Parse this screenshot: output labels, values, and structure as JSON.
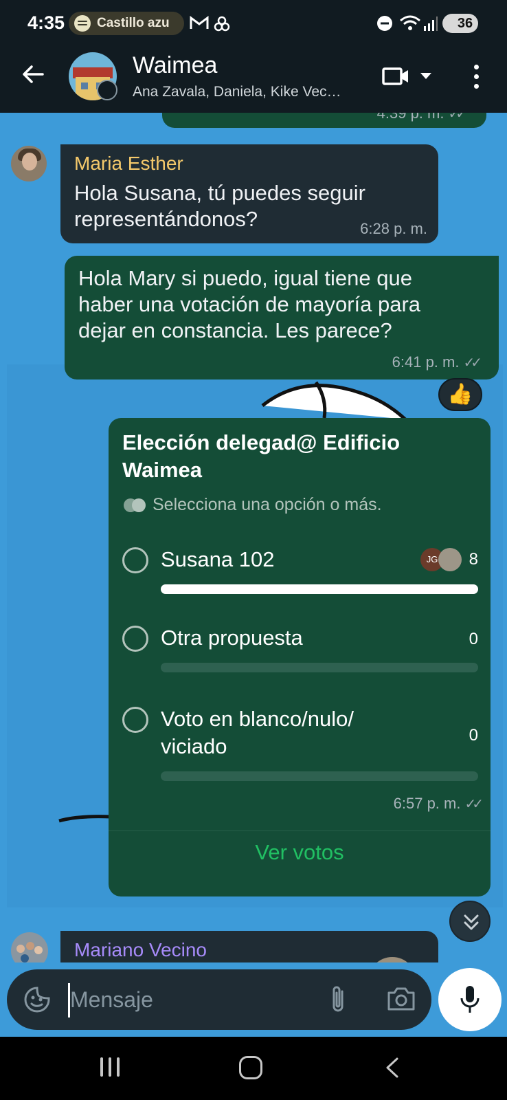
{
  "status_bar": {
    "time": "4:35",
    "media_pill_text": "Castillo azu",
    "battery": "36"
  },
  "header": {
    "title": "Waimea",
    "subtitle": "Ana Zavala, Daniela, Kike Vec…"
  },
  "messages": {
    "top_partial": {
      "time": "4:39 p. m."
    },
    "maria": {
      "sender": "Maria Esther",
      "text": "Hola Susana, tú puedes seguir representándonos?",
      "time": "6:28 p. m."
    },
    "susana": {
      "text": "Hola Mary si puedo, igual tiene que haber una votación de mayoría para dejar en constancia. Les parece?",
      "time": "6:41 p. m.",
      "reaction": "👍"
    },
    "poll": {
      "title": "Elección delegad@ Edificio Waimea",
      "hint": "Selecciona una opción o más.",
      "options": [
        {
          "label": "Susana 102",
          "count": "8",
          "fraction": 1.0,
          "voter_initials": "JG"
        },
        {
          "label": "Otra propuesta",
          "count": "0",
          "fraction": 0.0
        },
        {
          "label": "Voto en blanco/nulo/ viciado",
          "count": "0",
          "fraction": 0.0
        }
      ],
      "time": "6:57 p. m.",
      "link": "Ver votos"
    },
    "mariano": {
      "sender": "Mariano Vecino"
    }
  },
  "composer": {
    "placeholder": "Mensaje"
  },
  "colors": {
    "wallpaper": "#3d9bd9",
    "incoming_bubble": "#1f2c34",
    "outgoing_bubble": "#144d37",
    "accent_green": "#21c063",
    "maria_name": "#f4c96b",
    "mariano_name": "#a78bfa"
  }
}
